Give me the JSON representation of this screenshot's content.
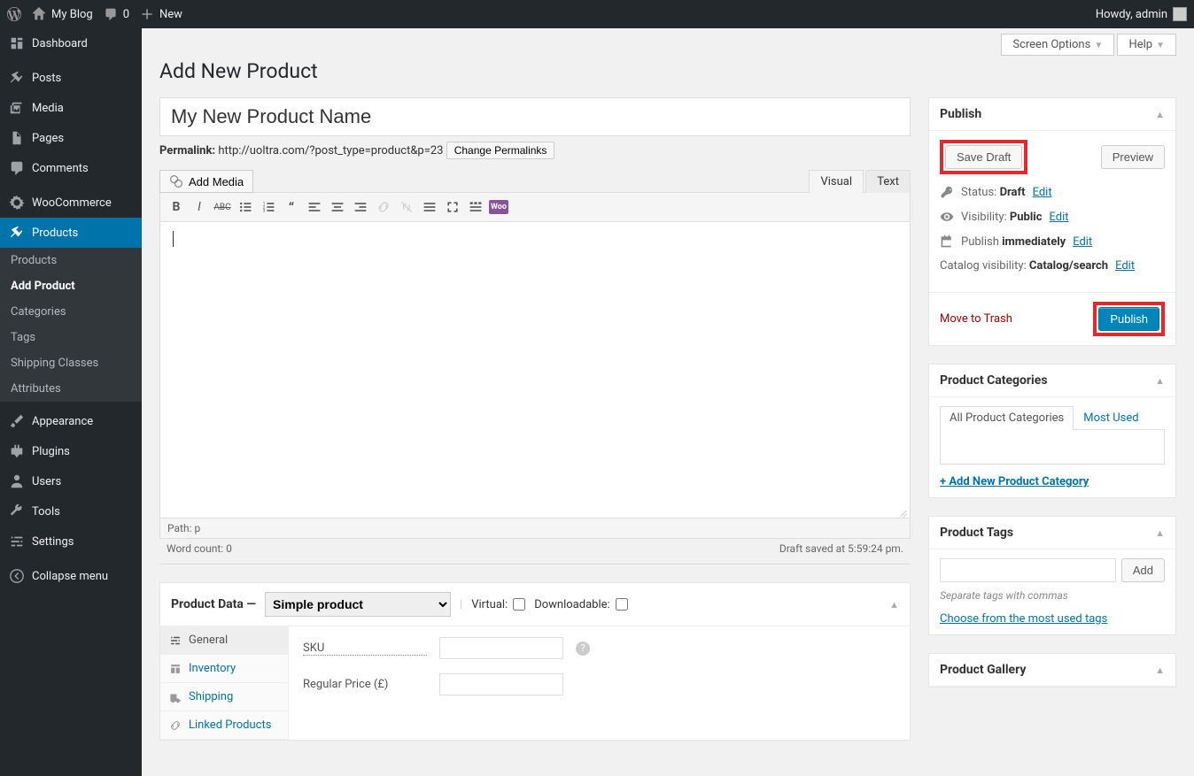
{
  "adminbar": {
    "site_name": "My Blog",
    "comments_count": "0",
    "new_label": "New",
    "howdy": "Howdy, admin"
  },
  "sidemenu": {
    "dashboard": "Dashboard",
    "posts": "Posts",
    "media": "Media",
    "pages": "Pages",
    "comments": "Comments",
    "woocommerce": "WooCommerce",
    "products": "Products",
    "appearance": "Appearance",
    "plugins": "Plugins",
    "users": "Users",
    "tools": "Tools",
    "settings": "Settings",
    "collapse": "Collapse menu"
  },
  "submenu": {
    "products": "Products",
    "add_product": "Add Product",
    "categories": "Categories",
    "tags": "Tags",
    "shipping_classes": "Shipping Classes",
    "attributes": "Attributes"
  },
  "topright": {
    "screen_options": "Screen Options",
    "help": "Help"
  },
  "page_title": "Add New Product",
  "title_value": "My New Product Name",
  "permalink": {
    "label": "Permalink:",
    "url": "http://uoltra.com/?post_type=product&p=23",
    "change": "Change Permalinks"
  },
  "editor": {
    "add_media": "Add Media",
    "visual": "Visual",
    "text": "Text",
    "path_label": "Path:",
    "path_value": "p",
    "word_count": "Word count: 0",
    "saved": "Draft saved at 5:59:24 pm."
  },
  "product_data": {
    "header_label": "Product Data —",
    "type_selected": "Simple product",
    "virtual_label": "Virtual:",
    "downloadable_label": "Downloadable:",
    "tabs": {
      "general": "General",
      "inventory": "Inventory",
      "shipping": "Shipping",
      "linked": "Linked Products"
    },
    "fields": {
      "sku_label": "SKU",
      "regular_price_label": "Regular Price (£)"
    }
  },
  "publish": {
    "title": "Publish",
    "save_draft": "Save Draft",
    "preview": "Preview",
    "status_label": "Status:",
    "status_value": "Draft",
    "visibility_label": "Visibility:",
    "visibility_value": "Public",
    "publish_label": "Publish",
    "publish_value": "immediately",
    "catalog_label": "Catalog visibility:",
    "catalog_value": "Catalog/search",
    "edit": "Edit",
    "trash": "Move to Trash",
    "publish_btn": "Publish"
  },
  "categories": {
    "title": "Product Categories",
    "all": "All Product Categories",
    "most_used": "Most Used",
    "add_new": "+ Add New Product Category"
  },
  "tags": {
    "title": "Product Tags",
    "add": "Add",
    "help": "Separate tags with commas",
    "choose": "Choose from the most used tags"
  },
  "gallery": {
    "title": "Product Gallery"
  }
}
